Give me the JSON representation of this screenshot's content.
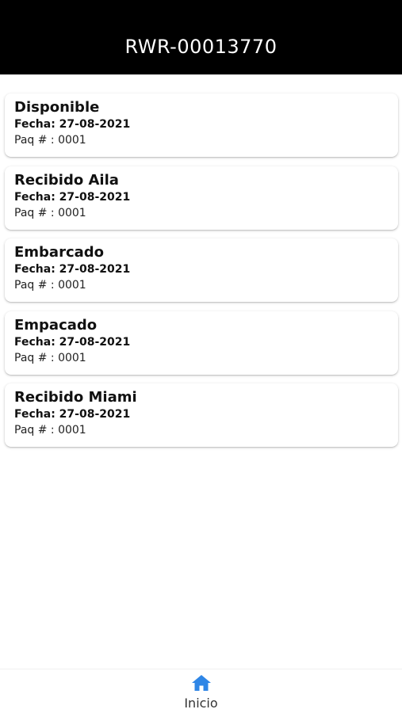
{
  "header": {
    "title": "RWR-00013770"
  },
  "items": [
    {
      "status": "Disponible",
      "date": "Fecha: 27-08-2021",
      "package": "Paq # : 0001"
    },
    {
      "status": "Recibido Aila",
      "date": "Fecha: 27-08-2021",
      "package": "Paq # : 0001"
    },
    {
      "status": "Embarcado",
      "date": "Fecha: 27-08-2021",
      "package": "Paq # : 0001"
    },
    {
      "status": "Empacado",
      "date": "Fecha: 27-08-2021",
      "package": "Paq # : 0001"
    },
    {
      "status": "Recibido Miami",
      "date": "Fecha: 27-08-2021",
      "package": "Paq # : 0001"
    }
  ],
  "tabbar": {
    "home_label": "Inicio",
    "home_icon": "home-icon",
    "accent_color": "#2f86e6"
  },
  "colors": {
    "header_bg": "#000000",
    "header_text": "#ffffff"
  }
}
